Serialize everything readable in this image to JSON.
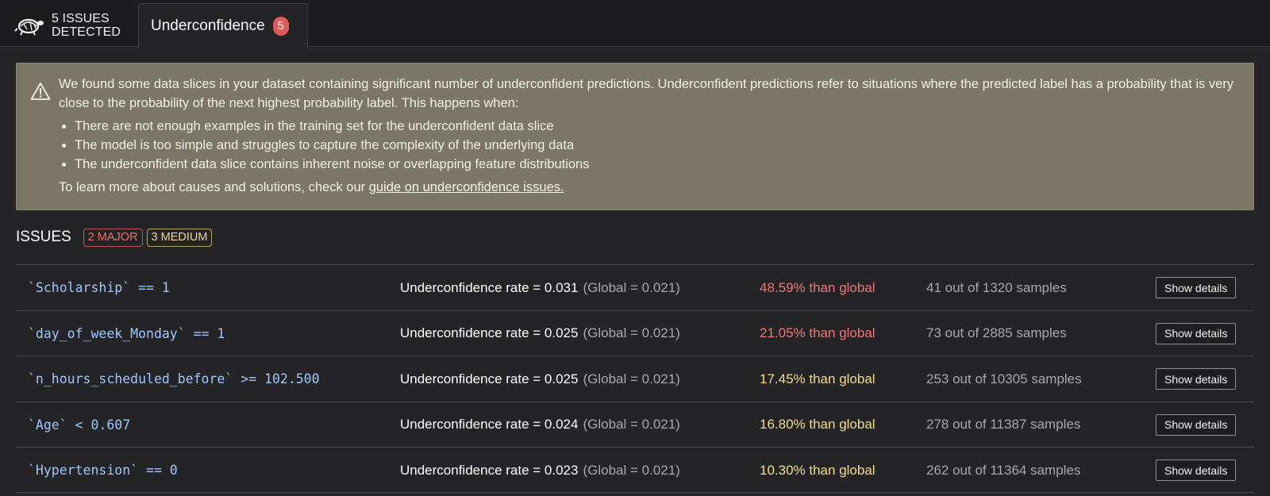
{
  "header": {
    "brand_text": "5 ISSUES\nDETECTED",
    "tab": {
      "label": "Underconfidence",
      "count": "5"
    }
  },
  "alert": {
    "intro": "We found some data slices in your dataset containing significant number of underconfident predictions. Underconfident predictions refer to situations where the predicted label has a probability that is very close to the probability of the next highest probability label. This happens when:",
    "bullets": [
      "There are not enough examples in the training set for the underconfident data slice",
      "The model is too simple and struggles to capture the complexity of the underlying data",
      "The underconfident data slice contains inherent noise or overlapping feature distributions"
    ],
    "footer_prefix": "To learn more about causes and solutions, check our",
    "footer_link": "guide on underconfidence issues."
  },
  "issues": {
    "title": "ISSUES",
    "major_badge": "2 MAJOR",
    "medium_badge": "3 MEDIUM",
    "rows": [
      {
        "slice": "`Scholarship` == 1",
        "metric": "Underconfidence rate = 0.031",
        "global": "(Global = 0.021)",
        "delta": "48.59% than global",
        "severity": "major",
        "samples": "41 out of 1320 samples",
        "action": "Show details"
      },
      {
        "slice": "`day_of_week_Monday` == 1",
        "metric": "Underconfidence rate = 0.025",
        "global": "(Global = 0.021)",
        "delta": "21.05% than global",
        "severity": "major",
        "samples": "73 out of 2885 samples",
        "action": "Show details"
      },
      {
        "slice": "`n_hours_scheduled_before` >= 102.500",
        "metric": "Underconfidence rate = 0.025",
        "global": "(Global = 0.021)",
        "delta": "17.45% than global",
        "severity": "medium",
        "samples": "253 out of 10305 samples",
        "action": "Show details"
      },
      {
        "slice": "`Age` < 0.607",
        "metric": "Underconfidence rate = 0.024",
        "global": "(Global = 0.021)",
        "delta": "16.80% than global",
        "severity": "medium",
        "samples": "278 out of 11387 samples",
        "action": "Show details"
      },
      {
        "slice": "`Hypertension` == 0",
        "metric": "Underconfidence rate = 0.023",
        "global": "(Global = 0.021)",
        "delta": "10.30% than global",
        "severity": "medium",
        "samples": "262 out of 11364 samples",
        "action": "Show details"
      }
    ]
  },
  "colors": {
    "alert_bg": "#7a7767",
    "major": "#ee7676",
    "medium": "#f4dc8c",
    "slice_code": "#9fc6ff"
  },
  "icons": {
    "brand": "turtle-logo-icon",
    "alert": "warning-triangle-icon"
  }
}
